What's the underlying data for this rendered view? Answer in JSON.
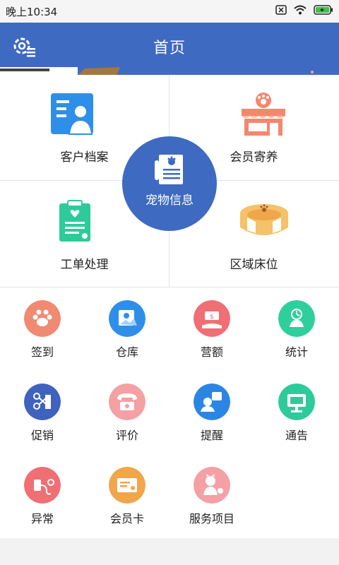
{
  "status_bar": {
    "time": "晚上10:34"
  },
  "header": {
    "title": "首页"
  },
  "main_grid": {
    "customer_file": "客户档案",
    "member_boarding": "会员寄养",
    "pet_info": "宠物信息",
    "work_order": "工单处理",
    "area_bed": "区域床位"
  },
  "small_grid": [
    {
      "label": "签到",
      "icon": "paw-icon",
      "color": "#f08a72"
    },
    {
      "label": "仓库",
      "icon": "warehouse-icon",
      "color": "#2f8fe8"
    },
    {
      "label": "营额",
      "icon": "revenue-icon",
      "color": "#ef6f74"
    },
    {
      "label": "统计",
      "icon": "statistics-icon",
      "color": "#2fcf9c"
    },
    {
      "label": "促销",
      "icon": "grooming-tools-icon",
      "color": "#3f62be"
    },
    {
      "label": "评价",
      "icon": "phone-icon",
      "color": "#f4a0a4"
    },
    {
      "label": "提醒",
      "icon": "reminder-icon",
      "color": "#2b86e3"
    },
    {
      "label": "通告",
      "icon": "notice-icon",
      "color": "#2ecb9a"
    },
    {
      "label": "异常",
      "icon": "abnormal-icon",
      "color": "#ef6f74"
    },
    {
      "label": "会员卡",
      "icon": "member-card-icon",
      "color": "#f0a64a"
    },
    {
      "label": "服务项目",
      "icon": "service-icon",
      "color": "#f4a0a4"
    }
  ],
  "colors": {
    "header": "#3f6ac2",
    "accent_orange": "#f39a6b"
  }
}
